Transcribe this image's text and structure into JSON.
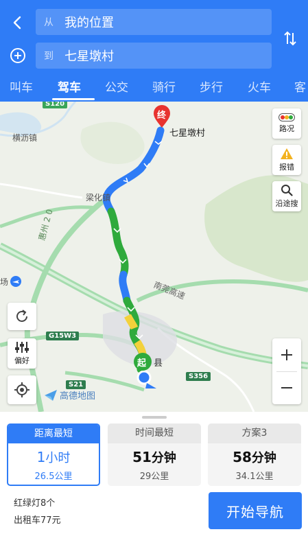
{
  "header": {
    "from_prefix": "从",
    "from_value": "我的位置",
    "to_prefix": "到",
    "to_value": "七星墩村",
    "icons": {
      "back": "back-arrow-icon",
      "add": "add-waypoint-icon",
      "swap": "swap-icon"
    }
  },
  "tabs": [
    {
      "label": "叫车"
    },
    {
      "label": "驾车",
      "active": true
    },
    {
      "label": "公交"
    },
    {
      "label": "骑行"
    },
    {
      "label": "步行"
    },
    {
      "label": "火车"
    },
    {
      "label": "客"
    }
  ],
  "map": {
    "labels": {
      "town1": "横沥镇",
      "town2": "梁化镇",
      "dest": "七星墩村",
      "highway": "南莞高速",
      "county": "县",
      "airport_partial": "场",
      "vertical_road": "惠州 2 0"
    },
    "shields": {
      "s120": "S120",
      "g15w3": "G15W3",
      "s21": "S21",
      "s356": "S356"
    },
    "markers": {
      "end": "终",
      "start": "起"
    },
    "side_buttons": {
      "traffic": "路况",
      "report": "报错",
      "search_along": "沿途搜",
      "preference": "偏好"
    },
    "logo_text": "高德地图",
    "colors": {
      "route_blue": "#2f7cf6",
      "route_green": "#2faa3c",
      "route_yellow": "#f3d13b",
      "road_green": "#a5dcae"
    }
  },
  "routes": [
    {
      "title": "距离最短",
      "time_num": "1",
      "time_unit": "小时",
      "distance": "26.5公里",
      "active": true
    },
    {
      "title": "时间最短",
      "time_num": "51",
      "time_unit": "分钟",
      "distance": "29公里"
    },
    {
      "title": "方案3",
      "time_num": "58",
      "time_unit": "分钟",
      "distance": "34.1公里"
    }
  ],
  "summary": {
    "traffic_lights": "红绿灯8个",
    "taxi": "出租车77元"
  },
  "actions": {
    "start_nav": "开始导航"
  }
}
